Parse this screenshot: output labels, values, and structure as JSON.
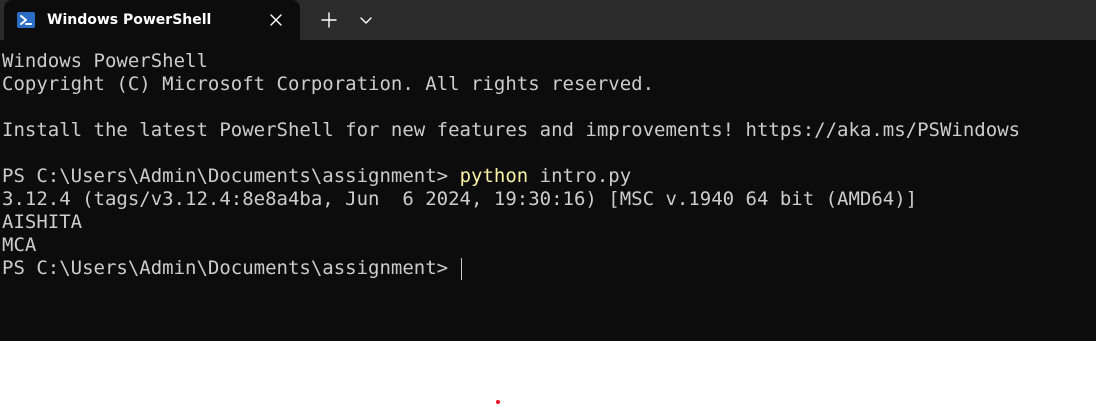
{
  "window": {
    "tab_title": "Windows PowerShell",
    "tab_icon": "powershell-icon",
    "close_icon": "close-icon",
    "new_tab_icon": "plus-icon",
    "dropdown_icon": "chevron-down-icon"
  },
  "terminal": {
    "lines": {
      "l0": "Windows PowerShell",
      "l1": "Copyright (C) Microsoft Corporation. All rights reserved.",
      "l2": "",
      "l3": "Install the latest PowerShell for new features and improvements! https://aka.ms/PSWindows",
      "l4": ""
    },
    "prompt1": "PS C:\\Users\\Admin\\Documents\\assignment> ",
    "command_name": "python",
    "command_args": " intro.py",
    "out": {
      "o0": "3.12.4 (tags/v3.12.4:8e8a4ba, Jun  6 2024, 19:30:16) [MSC v.1940 64 bit (AMD64)]",
      "o1": "AISHITA",
      "o2": "MCA"
    },
    "prompt2": "PS C:\\Users\\Admin\\Documents\\assignment> "
  },
  "colors": {
    "terminal_bg": "#0c0c0c",
    "titlebar_bg": "#2b2b2b",
    "text": "#cccccc",
    "command_highlight": "#f9f1a5",
    "icon_blue": "#2b6cc4"
  }
}
